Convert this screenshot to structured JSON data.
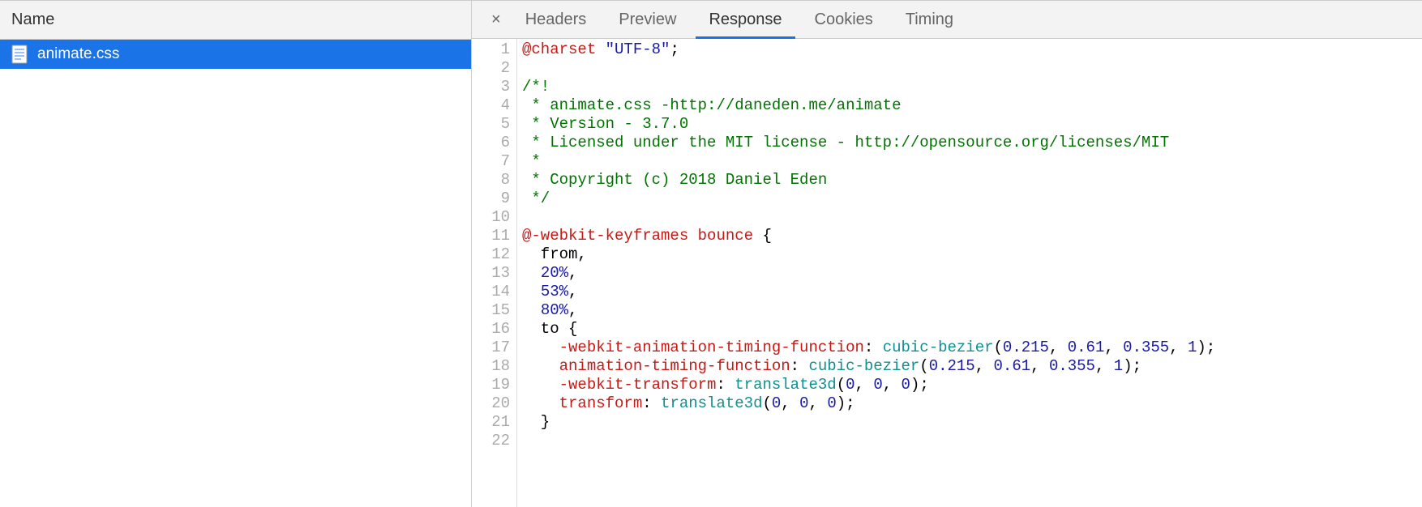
{
  "left": {
    "header": "Name",
    "files": [
      {
        "name": "animate.css",
        "selected": true
      }
    ]
  },
  "tabs": {
    "close_label": "×",
    "items": [
      {
        "id": "headers",
        "label": "Headers",
        "active": false
      },
      {
        "id": "preview",
        "label": "Preview",
        "active": false
      },
      {
        "id": "response",
        "label": "Response",
        "active": true
      },
      {
        "id": "cookies",
        "label": "Cookies",
        "active": false
      },
      {
        "id": "timing",
        "label": "Timing",
        "active": false
      }
    ]
  },
  "code": {
    "lines": [
      [
        {
          "t": "@charset ",
          "c": "atrule"
        },
        {
          "t": "\"UTF-8\"",
          "c": "string"
        },
        {
          "t": ";",
          "c": "punct"
        }
      ],
      [],
      [
        {
          "t": "/*!",
          "c": "comment"
        }
      ],
      [
        {
          "t": " * animate.css -http://daneden.me/animate",
          "c": "comment"
        }
      ],
      [
        {
          "t": " * Version - 3.7.0",
          "c": "comment"
        }
      ],
      [
        {
          "t": " * Licensed under the MIT license - http://opensource.org/licenses/MIT",
          "c": "comment"
        }
      ],
      [
        {
          "t": " *",
          "c": "comment"
        }
      ],
      [
        {
          "t": " * Copyright (c) 2018 Daniel Eden",
          "c": "comment"
        }
      ],
      [
        {
          "t": " */",
          "c": "comment"
        }
      ],
      [],
      [
        {
          "t": "@-webkit-keyframes",
          "c": "atrule"
        },
        {
          "t": " bounce ",
          "c": "sel"
        },
        {
          "t": "{",
          "c": "punct"
        }
      ],
      [
        {
          "t": "  from,",
          "c": "plain"
        }
      ],
      [
        {
          "t": "  ",
          "c": "plain"
        },
        {
          "t": "20%",
          "c": "number"
        },
        {
          "t": ",",
          "c": "plain"
        }
      ],
      [
        {
          "t": "  ",
          "c": "plain"
        },
        {
          "t": "53%",
          "c": "number"
        },
        {
          "t": ",",
          "c": "plain"
        }
      ],
      [
        {
          "t": "  ",
          "c": "plain"
        },
        {
          "t": "80%",
          "c": "number"
        },
        {
          "t": ",",
          "c": "plain"
        }
      ],
      [
        {
          "t": "  to ",
          "c": "plain"
        },
        {
          "t": "{",
          "c": "punct"
        }
      ],
      [
        {
          "t": "    ",
          "c": "plain"
        },
        {
          "t": "-webkit-animation-timing-function",
          "c": "property"
        },
        {
          "t": ": ",
          "c": "punct"
        },
        {
          "t": "cubic-bezier",
          "c": "value"
        },
        {
          "t": "(",
          "c": "punct"
        },
        {
          "t": "0.215",
          "c": "number"
        },
        {
          "t": ", ",
          "c": "punct"
        },
        {
          "t": "0.61",
          "c": "number"
        },
        {
          "t": ", ",
          "c": "punct"
        },
        {
          "t": "0.355",
          "c": "number"
        },
        {
          "t": ", ",
          "c": "punct"
        },
        {
          "t": "1",
          "c": "number"
        },
        {
          "t": ");",
          "c": "punct"
        }
      ],
      [
        {
          "t": "    ",
          "c": "plain"
        },
        {
          "t": "animation-timing-function",
          "c": "property"
        },
        {
          "t": ": ",
          "c": "punct"
        },
        {
          "t": "cubic-bezier",
          "c": "value"
        },
        {
          "t": "(",
          "c": "punct"
        },
        {
          "t": "0.215",
          "c": "number"
        },
        {
          "t": ", ",
          "c": "punct"
        },
        {
          "t": "0.61",
          "c": "number"
        },
        {
          "t": ", ",
          "c": "punct"
        },
        {
          "t": "0.355",
          "c": "number"
        },
        {
          "t": ", ",
          "c": "punct"
        },
        {
          "t": "1",
          "c": "number"
        },
        {
          "t": ");",
          "c": "punct"
        }
      ],
      [
        {
          "t": "    ",
          "c": "plain"
        },
        {
          "t": "-webkit-transform",
          "c": "property"
        },
        {
          "t": ": ",
          "c": "punct"
        },
        {
          "t": "translate3d",
          "c": "value"
        },
        {
          "t": "(",
          "c": "punct"
        },
        {
          "t": "0",
          "c": "number"
        },
        {
          "t": ", ",
          "c": "punct"
        },
        {
          "t": "0",
          "c": "number"
        },
        {
          "t": ", ",
          "c": "punct"
        },
        {
          "t": "0",
          "c": "number"
        },
        {
          "t": ");",
          "c": "punct"
        }
      ],
      [
        {
          "t": "    ",
          "c": "plain"
        },
        {
          "t": "transform",
          "c": "property"
        },
        {
          "t": ": ",
          "c": "punct"
        },
        {
          "t": "translate3d",
          "c": "value"
        },
        {
          "t": "(",
          "c": "punct"
        },
        {
          "t": "0",
          "c": "number"
        },
        {
          "t": ", ",
          "c": "punct"
        },
        {
          "t": "0",
          "c": "number"
        },
        {
          "t": ", ",
          "c": "punct"
        },
        {
          "t": "0",
          "c": "number"
        },
        {
          "t": ");",
          "c": "punct"
        }
      ],
      [
        {
          "t": "  }",
          "c": "punct"
        }
      ],
      []
    ]
  }
}
